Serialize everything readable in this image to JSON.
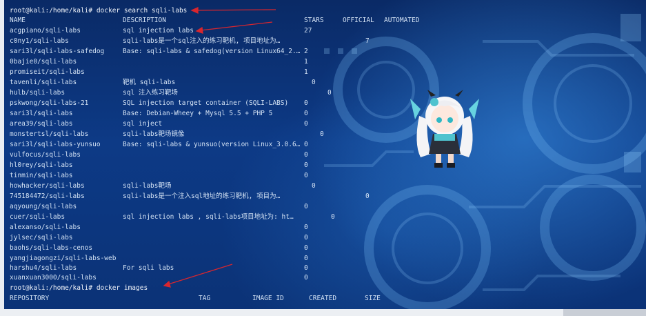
{
  "command1": "root@kali:/home/kali# docker search sqli-labs",
  "search_headers": {
    "name": "NAME",
    "description": "DESCRIPTION",
    "stars": "STARS",
    "official": "OFFICIAL",
    "automated": "AUTOMATED"
  },
  "results": [
    {
      "name": "acgpiano/sqli-labs",
      "description": "sql injection labs",
      "stars": "27"
    },
    {
      "name": "c0ny1/sqli-labs",
      "description": "sqli-labs是一个sql注入的练习靶机, 项目地址为…",
      "stars": "7"
    },
    {
      "name": "sari3l/sqli-labs-safedog",
      "description": "Base: sqli-labs & safedog(version Linux64_2.…",
      "stars": "2"
    },
    {
      "name": "0bajie0/sqli-labs",
      "description": "",
      "stars": "1"
    },
    {
      "name": "promiseit/sqli-labs",
      "description": "",
      "stars": "1"
    },
    {
      "name": "tavenli/sqli-labs",
      "description": "靶机 sqli-labs",
      "stars": "0"
    },
    {
      "name": "hulb/sqli-labs",
      "description": "sql 注入练习靶场",
      "stars": "0"
    },
    {
      "name": "pskwong/sqli-labs-21",
      "description": "SQL injection target container (SQLI-LABS)",
      "stars": "0"
    },
    {
      "name": "sari3l/sqli-labs",
      "description": "Base: Debian-Wheey + Mysql 5.5 + PHP 5",
      "stars": "0"
    },
    {
      "name": "area39/sqli-labs",
      "description": "sql inject",
      "stars": "0"
    },
    {
      "name": "monstertsl/sqli-labs",
      "description": "sqli-labs靶场镜像",
      "stars": "0"
    },
    {
      "name": "sari3l/sqli-labs-yunsuo",
      "description": "Base: sqli-labs & yunsuo(version Linux_3.0.6…",
      "stars": "0"
    },
    {
      "name": "vulfocus/sqli-labs",
      "description": "",
      "stars": "0"
    },
    {
      "name": "hl0rey/sqli-labs",
      "description": "",
      "stars": "0"
    },
    {
      "name": "tinmin/sqli-labs",
      "description": "",
      "stars": "0"
    },
    {
      "name": "howhacker/sqli-labs",
      "description": "sqli-labs靶场",
      "stars": "0"
    },
    {
      "name": "745184472/sqli-labs",
      "description": "sqli-labs是一个注入sql地址的练习靶机, 项目为…",
      "stars": "0"
    },
    {
      "name": "aqyoung/sqli-labs",
      "description": "",
      "stars": "0"
    },
    {
      "name": "cuer/sqli-labs",
      "description": "sql injection labs , sqli-labs项目地址为: ht…",
      "stars": "0"
    },
    {
      "name": "alexanso/sqli-labs",
      "description": "",
      "stars": "0"
    },
    {
      "name": "jylsec/sqli-labs",
      "description": "",
      "stars": "0"
    },
    {
      "name": "baohs/sqli-labs-cenos",
      "description": "",
      "stars": "0"
    },
    {
      "name": "yangjiagongzi/sqli-labs-web",
      "description": "",
      "stars": "0"
    },
    {
      "name": "harshu4/sqli-labs",
      "description": "For sqli labs",
      "stars": "0"
    },
    {
      "name": "xuanxuan3000/sqli-labs",
      "description": "",
      "stars": "0"
    }
  ],
  "command2": "root@kali:/home/kali# docker images",
  "images_headers": {
    "repository": "REPOSITORY",
    "tag": "TAG",
    "image_id": "IMAGE ID",
    "created": "CREATED",
    "size": "SIZE"
  },
  "colors": {
    "terminal_text": "#d4e3f5",
    "annotation_arrow": "#d8262e",
    "background": "#0b2f6e"
  }
}
